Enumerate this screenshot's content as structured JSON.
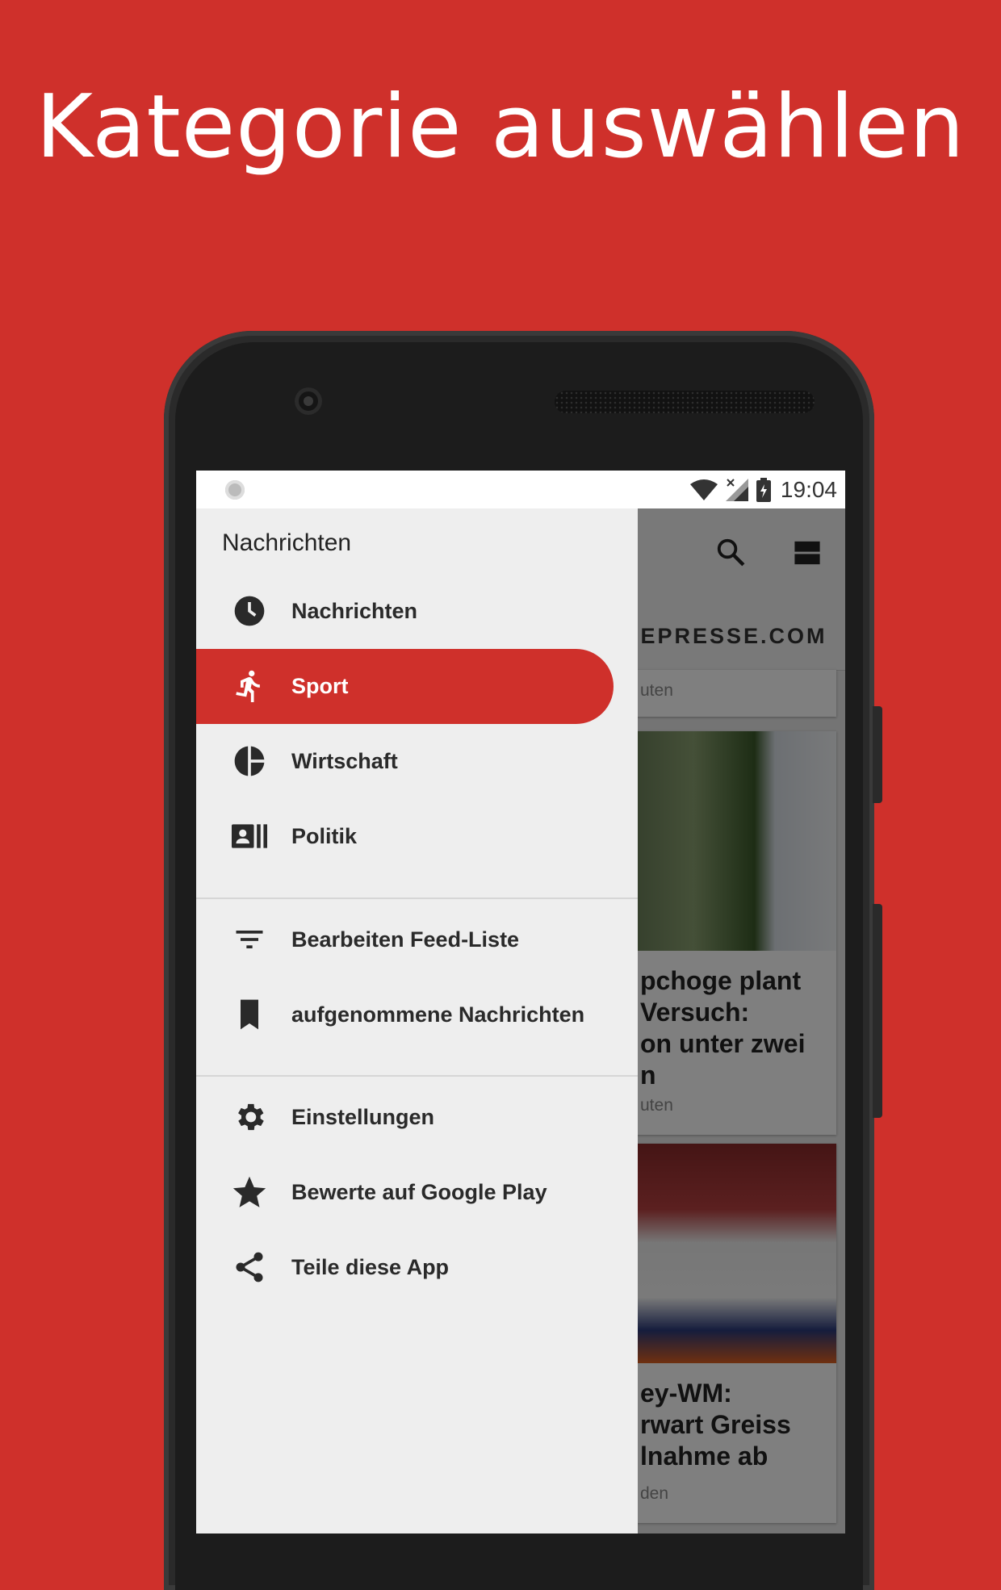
{
  "headline": "Kategorie auswählen",
  "status_bar": {
    "time": "19:04"
  },
  "app": {
    "source": "IEPRESSE.COM",
    "cards": [
      {
        "meta": "uten",
        "title": ""
      },
      {
        "meta": "uten",
        "title_lines": [
          "pchoge plant",
          " Versuch:",
          "on unter zwei",
          "n"
        ]
      },
      {
        "meta": "den",
        "title_lines": [
          "ey-WM:",
          "rwart Greiss",
          "lnahme ab"
        ]
      }
    ]
  },
  "drawer": {
    "title": "Nachrichten",
    "categories": [
      {
        "label": "Nachrichten",
        "icon": "clock-icon",
        "active": false
      },
      {
        "label": "Sport",
        "icon": "running-icon",
        "active": true
      },
      {
        "label": "Wirtschaft",
        "icon": "pie-chart-icon",
        "active": false
      },
      {
        "label": "Politik",
        "icon": "contact-card-icon",
        "active": false
      }
    ],
    "actions": [
      {
        "label": "Bearbeiten Feed-Liste",
        "icon": "filter-icon"
      },
      {
        "label": "aufgenommene Nachrichten",
        "icon": "bookmark-icon"
      }
    ],
    "misc": [
      {
        "label": "Einstellungen",
        "icon": "gear-icon"
      },
      {
        "label": "Bewerte auf Google Play",
        "icon": "star-icon"
      },
      {
        "label": "Teile diese App",
        "icon": "share-icon"
      }
    ]
  },
  "colors": {
    "brand": "#cf302b",
    "drawer_bg": "#eeeeee",
    "icon": "#2a2a2a"
  }
}
